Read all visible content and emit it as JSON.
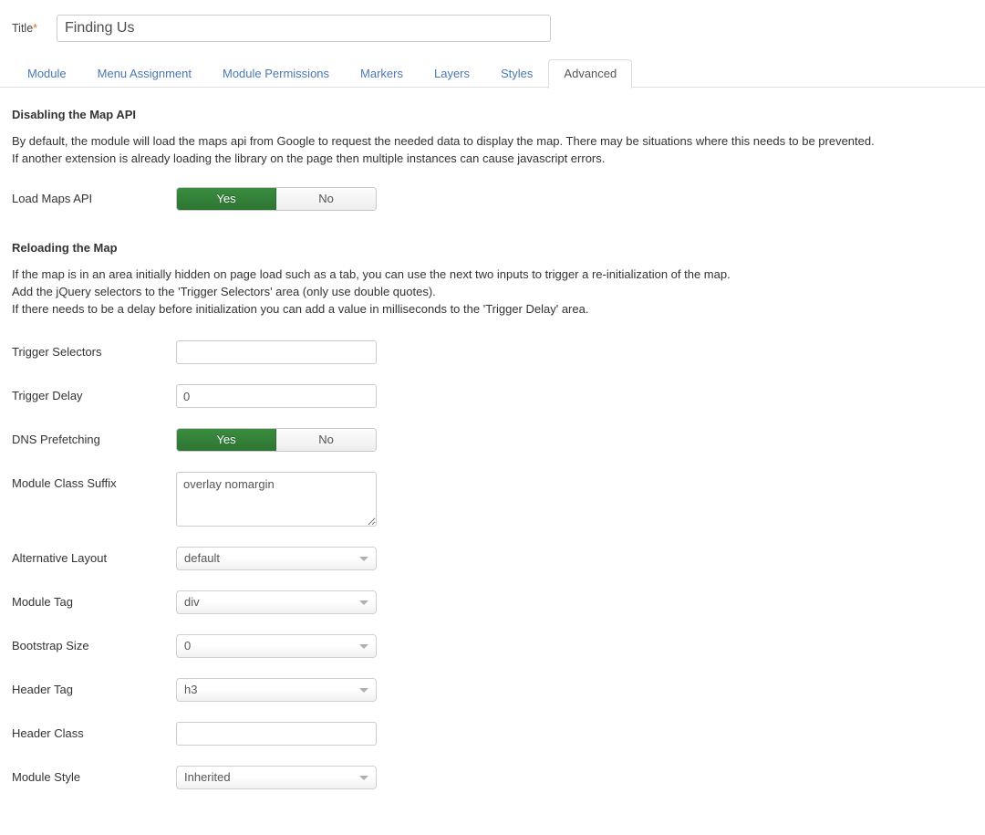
{
  "title_field": {
    "label": "Title",
    "required_mark": "*",
    "value": "Finding Us",
    "placeholder": ""
  },
  "tabs": [
    {
      "label": "Module",
      "active": false
    },
    {
      "label": "Menu Assignment",
      "active": false
    },
    {
      "label": "Module Permissions",
      "active": false
    },
    {
      "label": "Markers",
      "active": false
    },
    {
      "label": "Layers",
      "active": false
    },
    {
      "label": "Styles",
      "active": false
    },
    {
      "label": "Advanced",
      "active": true
    }
  ],
  "sections": {
    "disabling": {
      "heading": "Disabling the Map API",
      "paragraph_line1": "By default, the module will load the maps api from Google to request the needed data to display the map. There may be situations where this needs to be prevented.",
      "paragraph_line2": "If another extension is already loading the library on the page then multiple instances can cause javascript errors."
    },
    "reloading": {
      "heading": "Reloading the Map",
      "paragraph_line1": "If the map is in an area initially hidden on page load such as a tab, you can use the next two inputs to trigger a re-initialization of the map.",
      "paragraph_line2": "Add the jQuery selectors to the 'Trigger Selectors' area (only use double quotes).",
      "paragraph_line3": "If there needs to be a delay before initialization you can add a value in milliseconds to the 'Trigger Delay' area."
    }
  },
  "fields": {
    "load_maps_api": {
      "label": "Load Maps API",
      "yes_label": "Yes",
      "no_label": "No",
      "selected": "Yes"
    },
    "trigger_selectors": {
      "label": "Trigger Selectors",
      "value": "",
      "placeholder": ""
    },
    "trigger_delay": {
      "label": "Trigger Delay",
      "value": "0",
      "placeholder": ""
    },
    "dns_prefetching": {
      "label": "DNS Prefetching",
      "yes_label": "Yes",
      "no_label": "No",
      "selected": "Yes"
    },
    "module_class_suffix": {
      "label": "Module Class Suffix",
      "value": "overlay nomargin",
      "placeholder": ""
    },
    "alternative_layout": {
      "label": "Alternative Layout",
      "value": "default"
    },
    "module_tag": {
      "label": "Module Tag",
      "value": "div"
    },
    "bootstrap_size": {
      "label": "Bootstrap Size",
      "value": "0"
    },
    "header_tag": {
      "label": "Header Tag",
      "value": "h3"
    },
    "header_class": {
      "label": "Header Class",
      "value": "",
      "placeholder": ""
    },
    "module_style": {
      "label": "Module Style",
      "value": "Inherited"
    }
  },
  "colors": {
    "toggle_on_green": "#2e7532",
    "tab_link_blue": "#4a77b4",
    "required_orange": "#d9701a",
    "text_dark": "#333333",
    "border_grey": "#cccccc"
  }
}
